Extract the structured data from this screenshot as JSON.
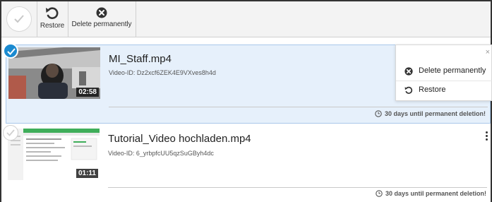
{
  "toolbar": {
    "restore_label": "Restore",
    "delete_label": "Delete permanently"
  },
  "videos": [
    {
      "title": "MI_Staff.mp4",
      "video_id": "Video-ID: Dz2xcf6ZEK4E9VXves8h4d",
      "duration": "02:58",
      "deletion_notice": "30 days until permanent deletion!",
      "selected": true
    },
    {
      "title": "Tutorial_Video hochladen.mp4",
      "video_id": "Video-ID: 6_yrbpfcUU5qzSuGByh4dc",
      "duration": "01:11",
      "deletion_notice": "30 days until permanent deletion!",
      "selected": false
    }
  ],
  "context_menu": {
    "close_glyph": "×",
    "delete_label": "Delete permanently",
    "restore_label": "Restore"
  },
  "colors": {
    "accent": "#1a8ad0",
    "selected_row_bg": "#e6f0fb",
    "toolbar_bg": "#f3f3f3"
  }
}
